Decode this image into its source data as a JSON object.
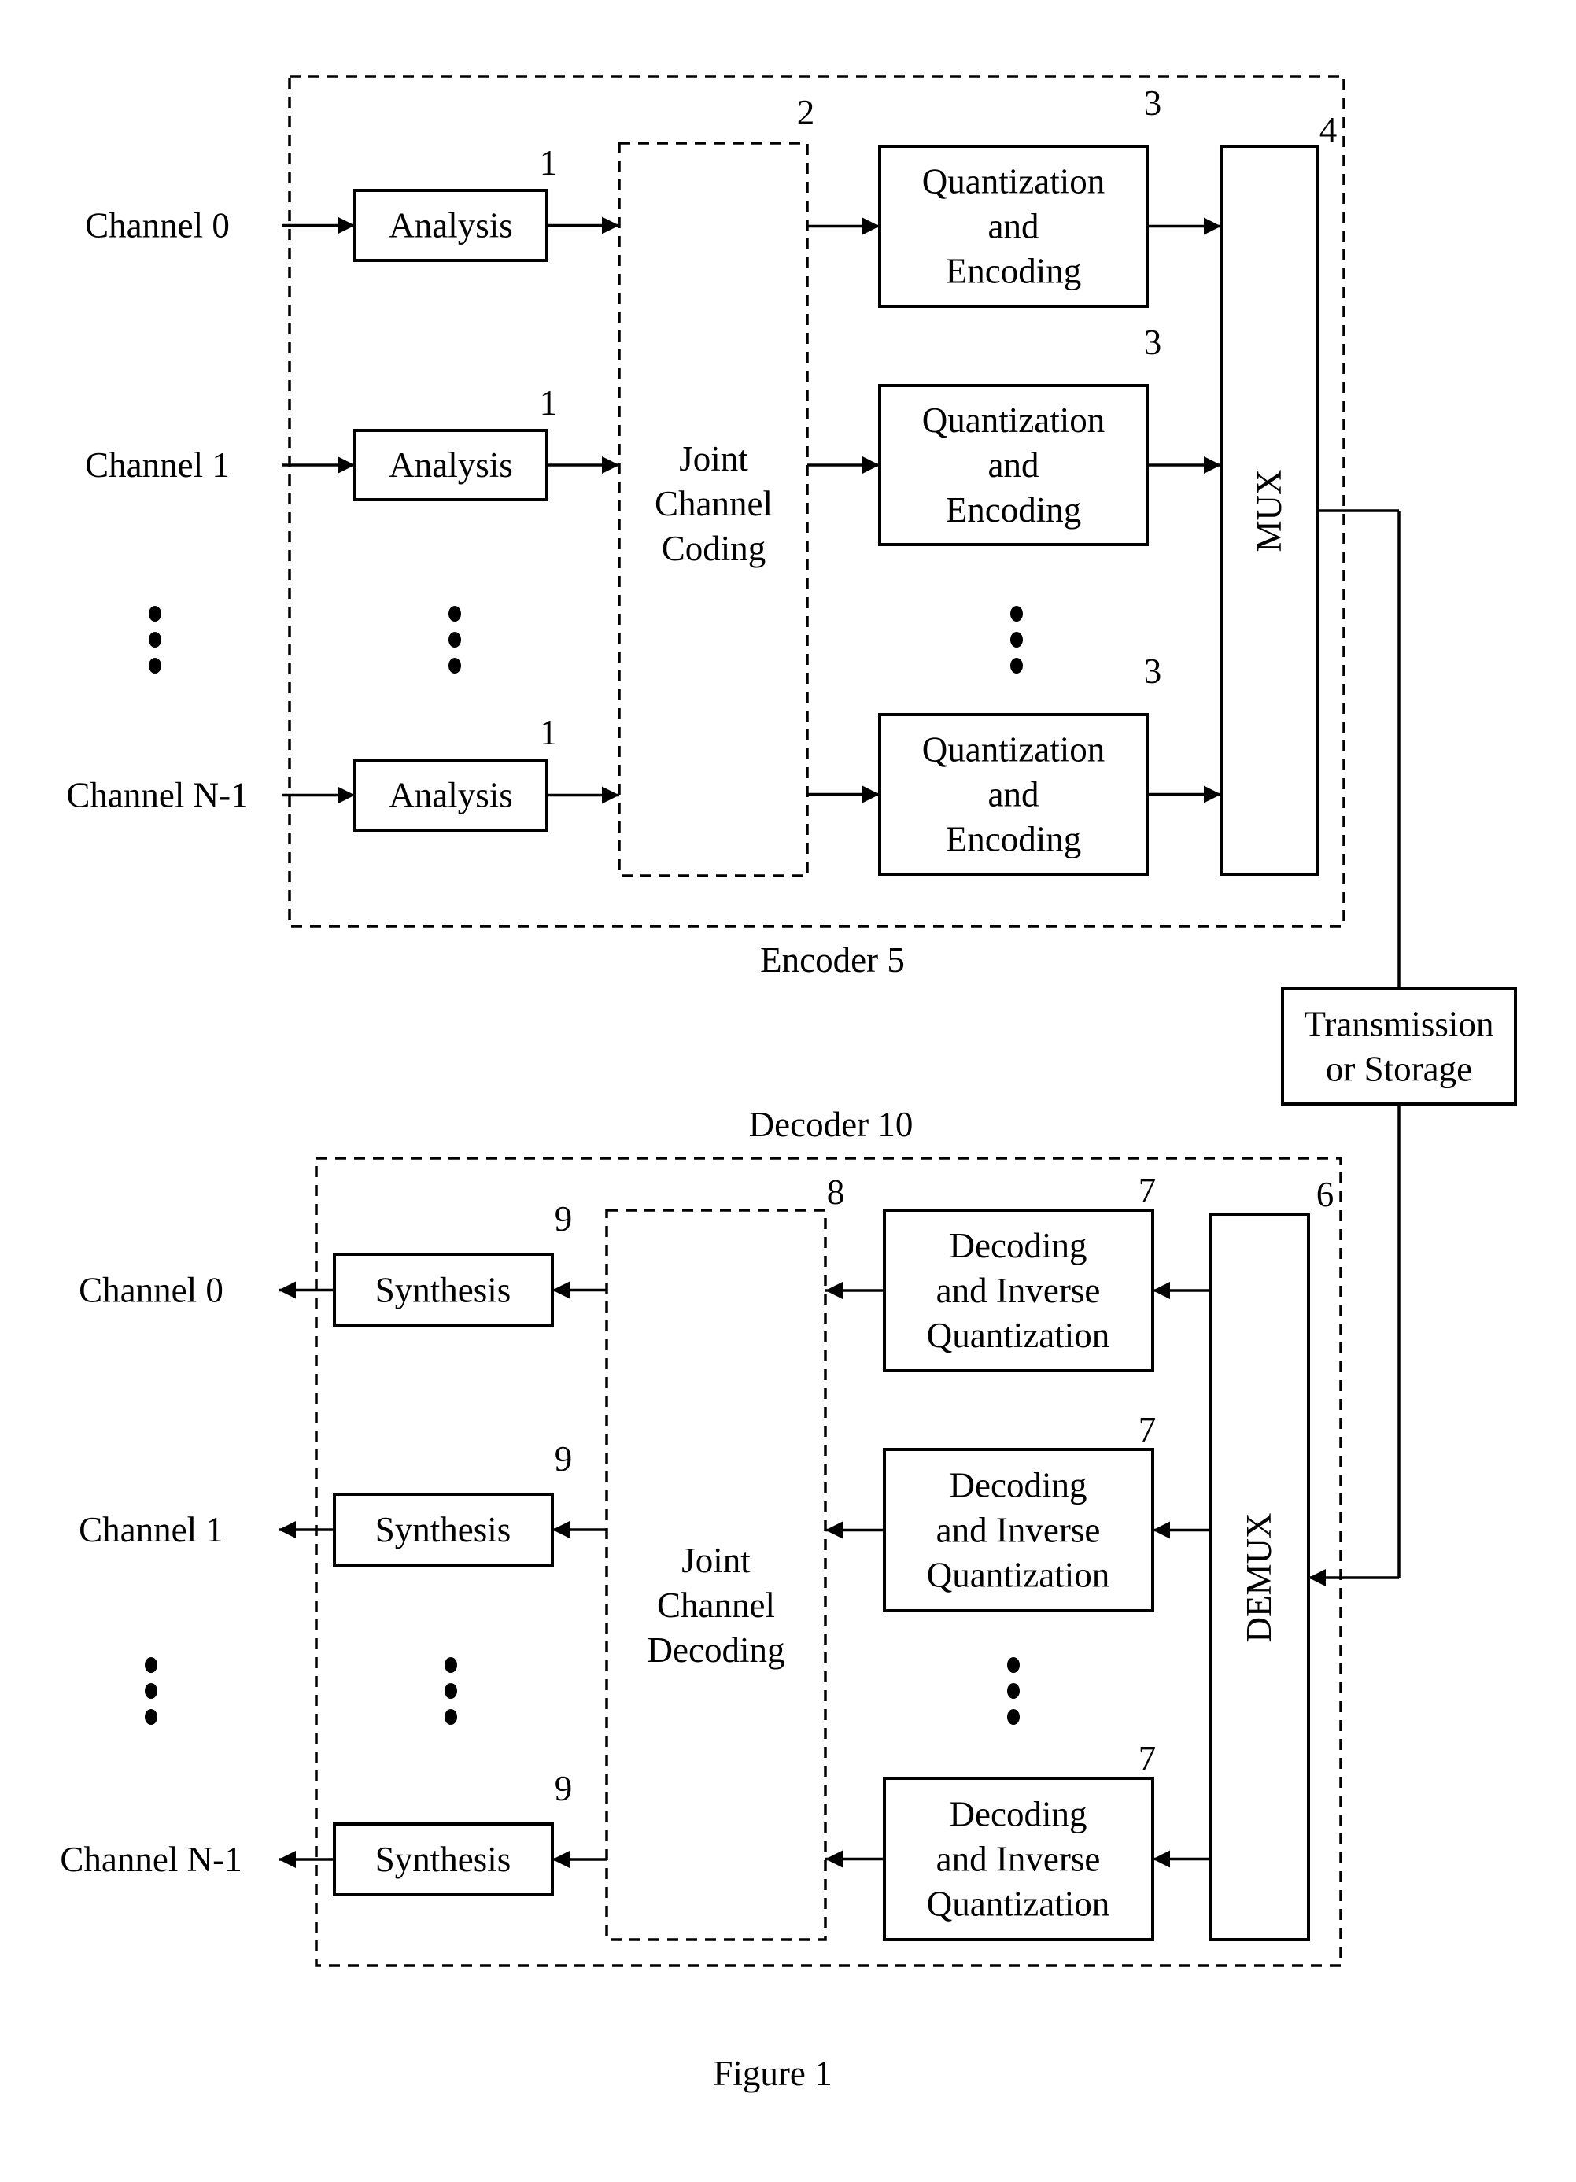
{
  "figure": {
    "caption": "Figure 1",
    "encoder": {
      "label": "Encoder 5",
      "ref": "5",
      "inputs": [
        "Channel 0",
        "Channel 1",
        "Channel N-1"
      ],
      "analysis": {
        "label": "Analysis",
        "ref": "1"
      },
      "joint": {
        "lines": [
          "Joint",
          "Channel",
          "Coding"
        ],
        "ref": "2"
      },
      "quant": {
        "lines": [
          "Quantization",
          "and",
          "Encoding"
        ],
        "ref": "3"
      },
      "mux": {
        "label": "MUX",
        "ref": "4"
      }
    },
    "channel": {
      "lines": [
        "Transmission",
        "or Storage"
      ]
    },
    "decoder": {
      "label": "Decoder 10",
      "ref": "10",
      "outputs": [
        "Channel 0",
        "Channel 1",
        "Channel N-1"
      ],
      "synthesis": {
        "label": "Synthesis",
        "ref": "9"
      },
      "joint": {
        "lines": [
          "Joint",
          "Channel",
          "Decoding"
        ],
        "ref": "8"
      },
      "dequant": {
        "lines": [
          "Decoding",
          "and Inverse",
          "Quantization"
        ],
        "ref": "7"
      },
      "demux": {
        "label": "DEMUX",
        "ref": "6"
      }
    }
  }
}
